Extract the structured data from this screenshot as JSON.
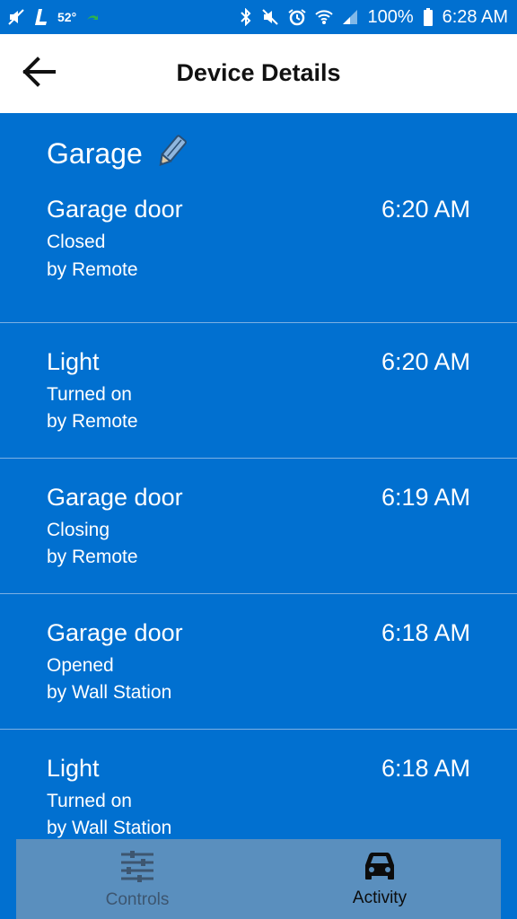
{
  "status_bar": {
    "temperature": "52°",
    "battery": "100%",
    "time": "6:28 AM",
    "icons_left": [
      "mute-icon",
      "l-app-icon",
      "phone-forward-icon"
    ],
    "icons_right": [
      "bluetooth-icon",
      "vibrate-off-icon",
      "alarm-icon",
      "wifi-icon",
      "signal-icon",
      "battery-icon"
    ]
  },
  "header": {
    "title": "Device Details",
    "back_icon": "arrow-left-icon"
  },
  "device": {
    "name": "Garage",
    "edit_icon": "pencil-icon"
  },
  "activities": [
    {
      "title": "Garage door",
      "time": "6:20 AM",
      "status": "Closed",
      "source": "by Remote"
    },
    {
      "title": "Light",
      "time": "6:20 AM",
      "status": "Turned on",
      "source": "by Remote"
    },
    {
      "title": "Garage door",
      "time": "6:19 AM",
      "status": "Closing",
      "source": "by Remote"
    },
    {
      "title": "Garage door",
      "time": "6:18 AM",
      "status": "Opened",
      "source": "by Wall Station"
    },
    {
      "title": "Light",
      "time": "6:18 AM",
      "status": "Turned on",
      "source": "by Wall Station"
    }
  ],
  "bottom_nav": {
    "tabs": [
      {
        "label": "Controls",
        "icon": "sliders-icon",
        "active": false
      },
      {
        "label": "Activity",
        "icon": "car-icon",
        "active": true
      }
    ]
  },
  "colors": {
    "primary": "#0170d0",
    "header_bg": "#ffffff",
    "nav_bg": "#5a8fbe",
    "divider": "#7db0e3"
  }
}
